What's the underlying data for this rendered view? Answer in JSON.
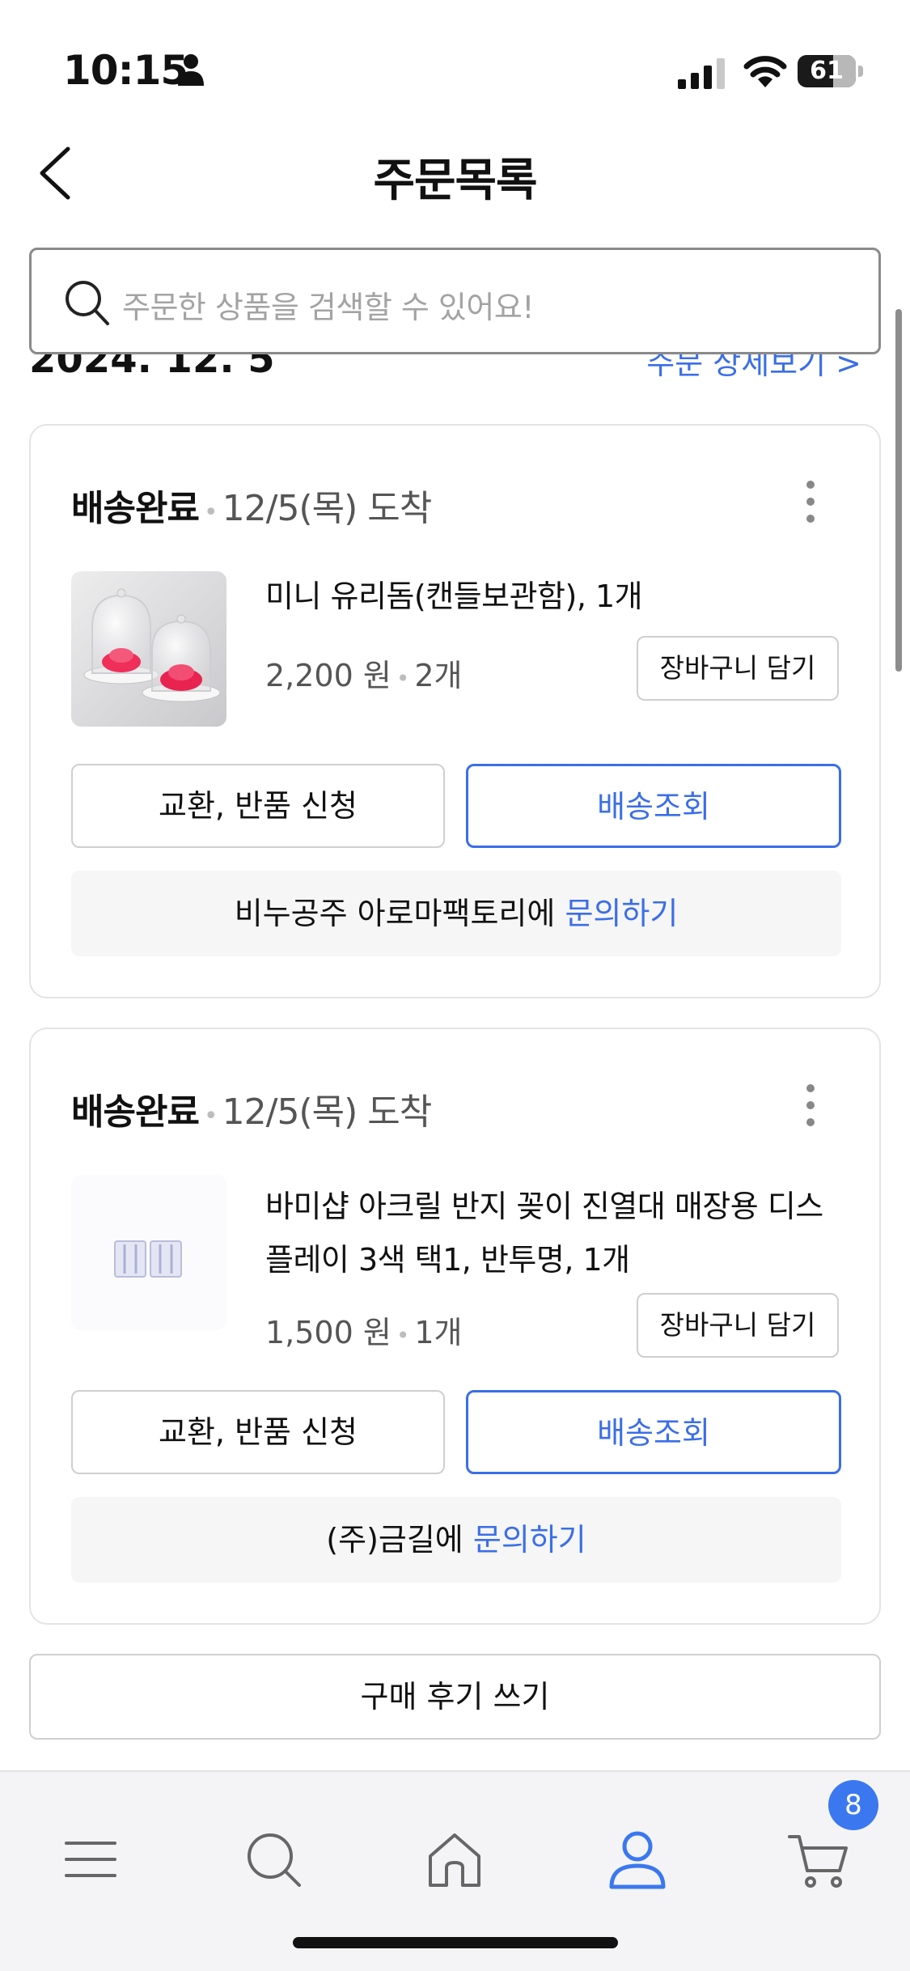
{
  "status_bar": {
    "time": "10:15",
    "battery": "61",
    "battery_level": 0.61
  },
  "header": {
    "title": "주문목록"
  },
  "search": {
    "placeholder": "주문한 상품을 검색할 수 있어요!"
  },
  "date_group": {
    "date": "2024. 12. 5",
    "detail_link": "주문 상세보기 >"
  },
  "orders": [
    {
      "status": "배송완료",
      "arrival": "12/5(목) 도착",
      "product_name": "미니 유리돔(캔들보관함), 1개",
      "price": "2,200 원",
      "quantity": "2개",
      "cart_button": "장바구니 담기",
      "exchange_button": "교환, 반품 신청",
      "track_button": "배송조회",
      "seller": "비누공주 아로마팩토리에",
      "inquiry_link": "문의하기"
    },
    {
      "status": "배송완료",
      "arrival": "12/5(목) 도착",
      "product_name": "바미샵 아크릴 반지 꽂이 진열대 매장용 디스플레이 3색 택1, 반투명, 1개",
      "price": "1,500 원",
      "quantity": "1개",
      "cart_button": "장바구니 담기",
      "exchange_button": "교환, 반품 신청",
      "track_button": "배송조회",
      "seller": "(주)금길에",
      "inquiry_link": "문의하기"
    }
  ],
  "review_button": "구매 후기 쓰기",
  "bottom_nav": {
    "items": [
      "menu-icon",
      "search-icon",
      "home-icon",
      "my-page-icon",
      "cart-icon"
    ],
    "cart_count": "8",
    "active_color": "#3b78f0"
  }
}
